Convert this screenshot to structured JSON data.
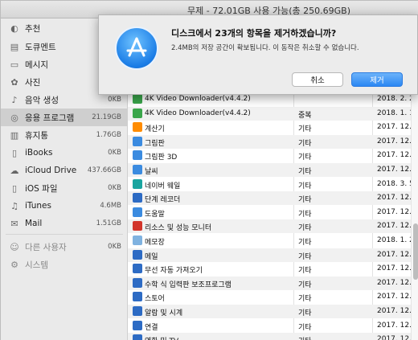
{
  "window": {
    "title": "무제 - 72.01GB 사용 가능(총 250.69GB)"
  },
  "sidebar": {
    "items": [
      {
        "label": "추천",
        "size": "",
        "icon": "lightbulb-icon",
        "glyph": "◐"
      },
      {
        "label": "도큐멘트",
        "size": "1",
        "icon": "document-icon",
        "glyph": "▤"
      },
      {
        "label": "메시지",
        "size": "",
        "icon": "messages-icon",
        "glyph": "▭"
      },
      {
        "label": "사진",
        "size": "",
        "icon": "photos-icon",
        "glyph": "✿"
      },
      {
        "label": "음악 생성",
        "size": "0KB",
        "icon": "guitar-icon",
        "glyph": "♪"
      },
      {
        "label": "응용 프로그램",
        "size": "21.19GB",
        "icon": "applications-icon",
        "glyph": "◎"
      },
      {
        "label": "휴지통",
        "size": "1.76GB",
        "icon": "trash-icon",
        "glyph": "▥"
      },
      {
        "label": "iBooks",
        "size": "0KB",
        "icon": "books-icon",
        "glyph": "▯"
      },
      {
        "label": "iCloud Drive",
        "size": "437.66GB",
        "icon": "cloud-icon",
        "glyph": "☁"
      },
      {
        "label": "iOS 파일",
        "size": "0KB",
        "icon": "phone-icon",
        "glyph": "▯"
      },
      {
        "label": "iTunes",
        "size": "4.6MB",
        "icon": "music-icon",
        "glyph": "♫"
      },
      {
        "label": "Mail",
        "size": "1.51GB",
        "icon": "mail-icon",
        "glyph": "✉"
      },
      {
        "label": "다른 사용자",
        "size": "0KB",
        "icon": "user-icon",
        "glyph": "☺"
      },
      {
        "label": "시스템",
        "size": "",
        "icon": "gear-icon",
        "glyph": "⚙"
      }
    ]
  },
  "rows": [
    {
      "name": "4K Video Downloader(v4.4.2)",
      "kind": "",
      "date": "2018. 2. 2",
      "color": "#3aa64b"
    },
    {
      "name": "4K Video Downloader(v4.4.2)",
      "kind": "중복",
      "date": "2018. 1. 11.",
      "color": "#3aa64b"
    },
    {
      "name": "계산기",
      "kind": "기타",
      "date": "2017. 12. 23",
      "color": "#ff8c00"
    },
    {
      "name": "그림판",
      "kind": "기타",
      "date": "2017. 12. 23",
      "color": "#3b8be0"
    },
    {
      "name": "그림판 3D",
      "kind": "기타",
      "date": "2017. 12. 23",
      "color": "#3b8be0"
    },
    {
      "name": "날씨",
      "kind": "기타",
      "date": "2017. 12. 23",
      "color": "#3b8be0"
    },
    {
      "name": "네이버 웨일",
      "kind": "기타",
      "date": "2018. 3. 5. 2",
      "color": "#1aa5a0"
    },
    {
      "name": "단계 레코더",
      "kind": "기타",
      "date": "2017. 12. 23",
      "color": "#2d6bc4"
    },
    {
      "name": "도움말",
      "kind": "기타",
      "date": "2017. 12. 23",
      "color": "#3b8be0"
    },
    {
      "name": "리소스 및 성능 모니터",
      "kind": "기타",
      "date": "2017. 12. 23",
      "color": "#d2352b"
    },
    {
      "name": "메모장",
      "kind": "기타",
      "date": "2018. 1. 22.",
      "color": "#7fb2e0"
    },
    {
      "name": "메일",
      "kind": "기타",
      "date": "2017. 12. 23",
      "color": "#2d6bc4"
    },
    {
      "name": "무선 자동 가져오기",
      "kind": "기타",
      "date": "2017. 12. 21",
      "color": "#2d6bc4"
    },
    {
      "name": "수학 식 입력판 보조프로그램",
      "kind": "기타",
      "date": "2017. 12. 23",
      "color": "#2d6bc4"
    },
    {
      "name": "스토어",
      "kind": "기타",
      "date": "2017. 12. 23",
      "color": "#2d6bc4"
    },
    {
      "name": "알람 및 시계",
      "kind": "기타",
      "date": "2017. 12. 23",
      "color": "#2d6bc4"
    },
    {
      "name": "연결",
      "kind": "기타",
      "date": "2017. 12. 23",
      "color": "#2d6bc4"
    },
    {
      "name": "영화 및 TV",
      "kind": "기타",
      "date": "2017. 12. 23",
      "color": "#2d6bc4"
    }
  ],
  "dialog": {
    "title": "디스크에서 23개의 항목을 제거하겠습니까?",
    "message": "2.4MB의 저장 공간이 확보됩니다. 이 동작은 취소할 수 없습니다.",
    "cancel_label": "취소",
    "remove_label": "제거"
  }
}
